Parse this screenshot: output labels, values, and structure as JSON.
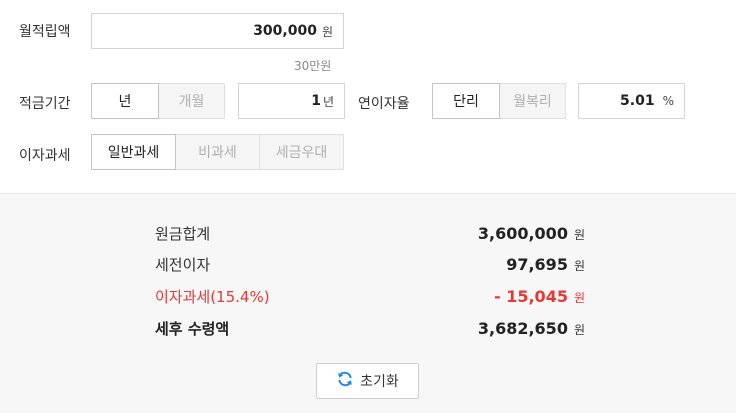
{
  "inputs": {
    "monthly_deposit": {
      "label": "월적립액",
      "value": "300,000",
      "unit": "원",
      "hint": "30만원"
    },
    "period": {
      "label": "적금기간",
      "options": [
        "년",
        "개월"
      ],
      "selected": "년",
      "value": "1",
      "unit": "년"
    },
    "interest": {
      "label": "연이자율",
      "options": [
        "단리",
        "월복리"
      ],
      "selected": "단리",
      "value": "5.01",
      "unit": "%"
    },
    "tax": {
      "label": "이자과세",
      "options": [
        "일반과세",
        "비과세",
        "세금우대"
      ],
      "selected": "일반과세"
    }
  },
  "results": {
    "principal": {
      "label": "원금합계",
      "value": "3,600,000",
      "unit": "원"
    },
    "pretax_interest": {
      "label": "세전이자",
      "value": "97,695",
      "unit": "원"
    },
    "interest_tax": {
      "label": "이자과세(15.4%)",
      "value": "- 15,045",
      "unit": "원"
    },
    "net_amount": {
      "label": "세후 수령액",
      "value": "3,682,650",
      "unit": "원"
    }
  },
  "reset_label": "초기화",
  "colors": {
    "accent_blue": "#1e88e5",
    "tax_red": "#e53935",
    "panel_bg": "#f7f7f7"
  },
  "icons": {
    "reset": "refresh-icon"
  }
}
